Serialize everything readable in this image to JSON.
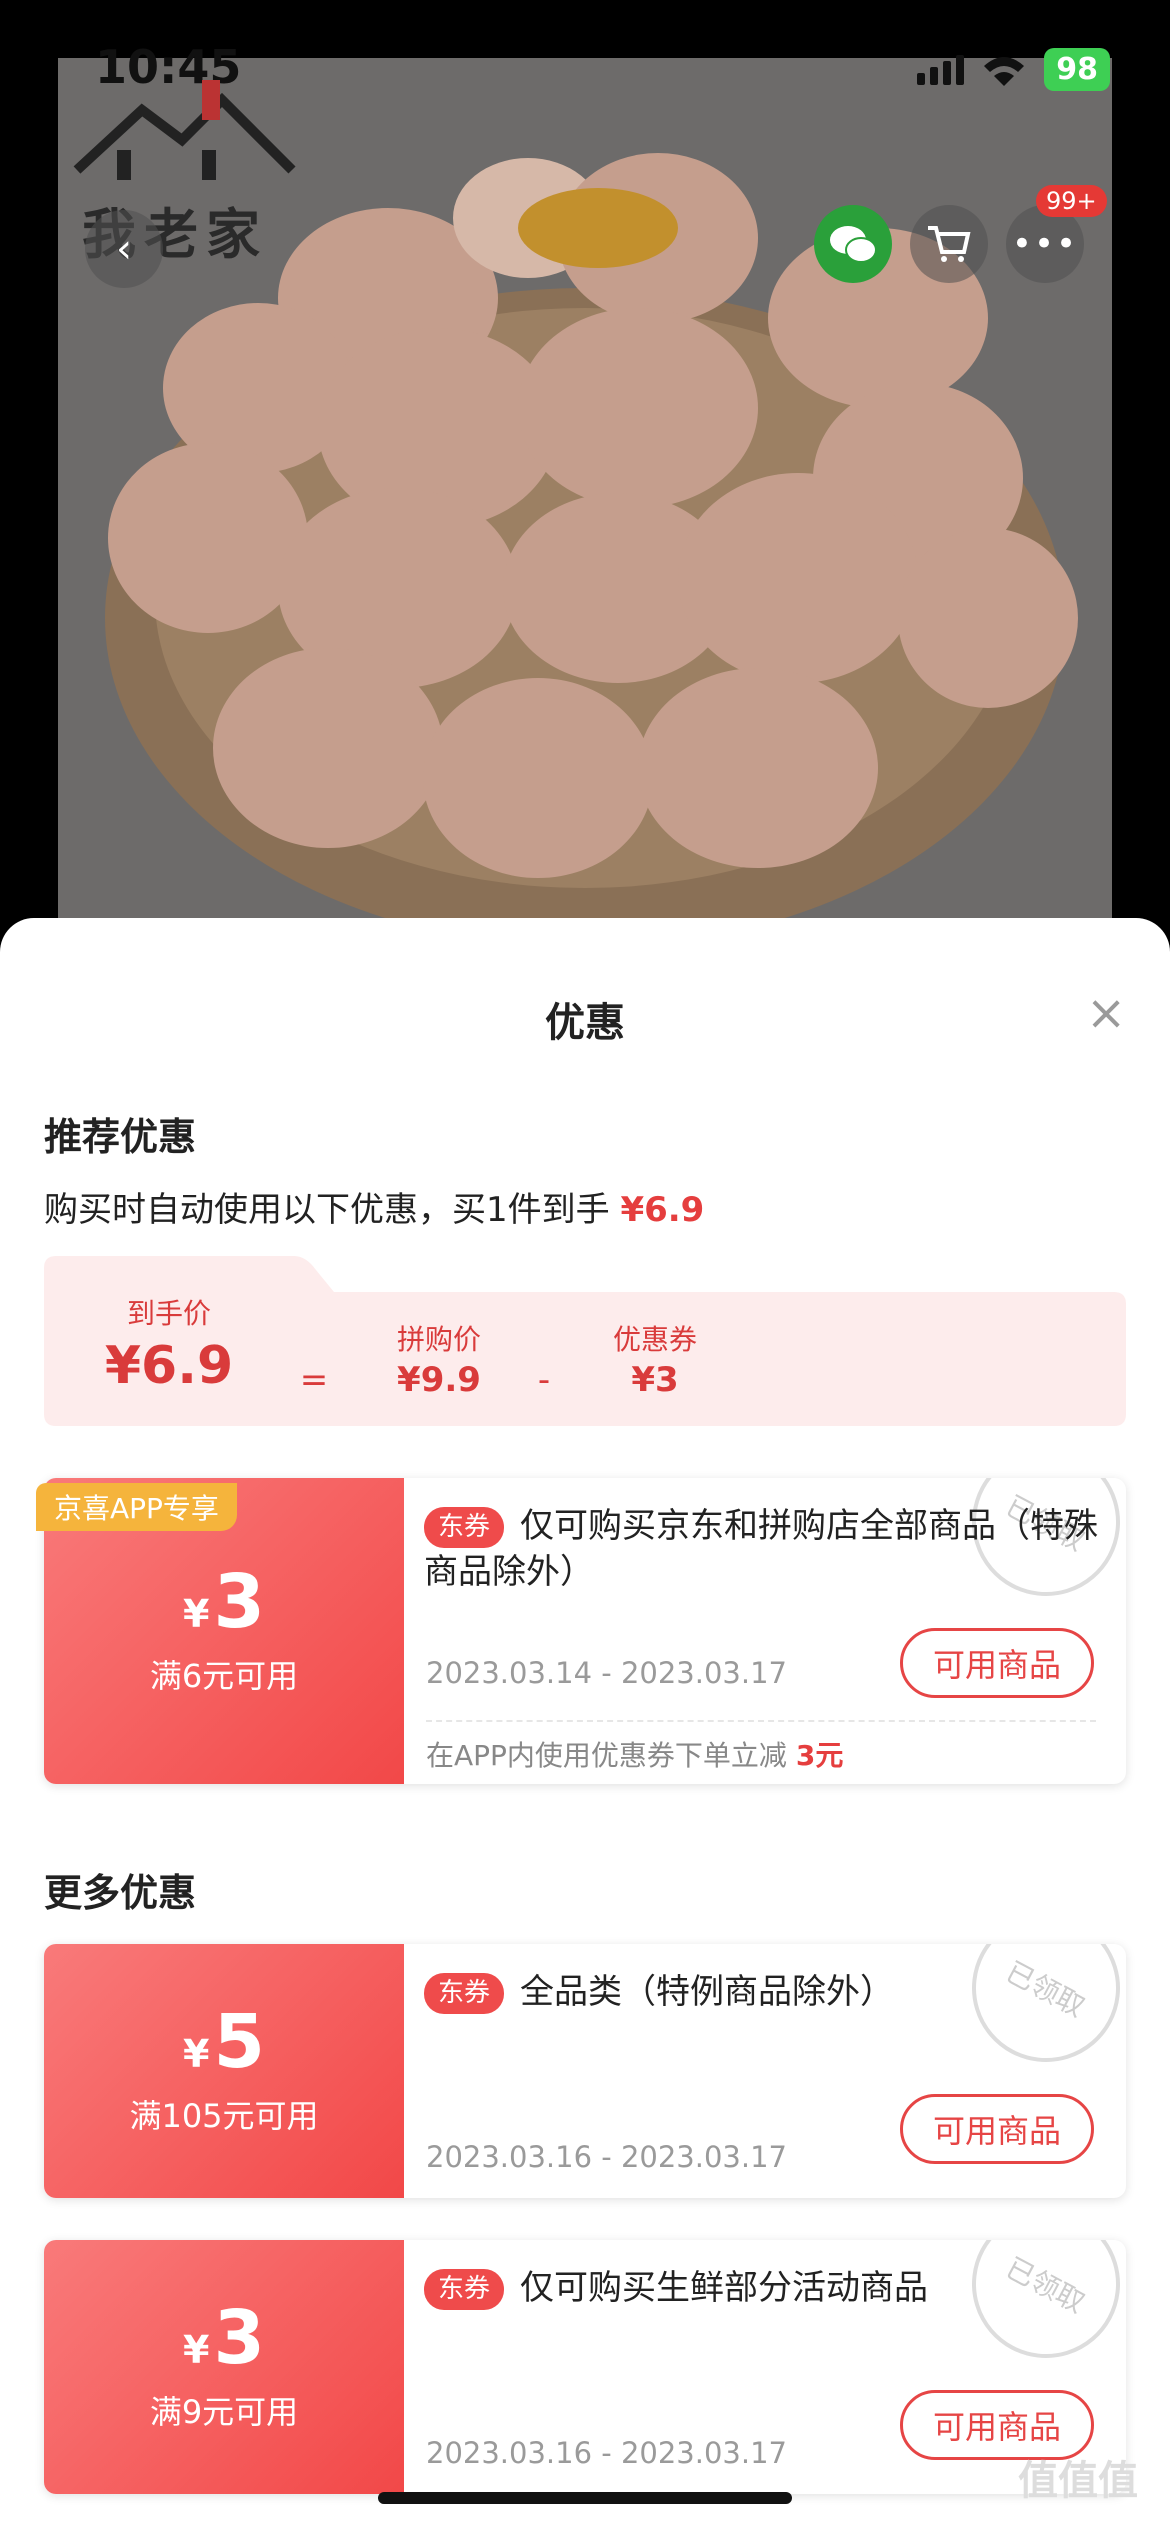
{
  "status_bar": {
    "time": "10:45",
    "battery": "98"
  },
  "product": {
    "logo_text": "我老家",
    "cart_badge": "99+"
  },
  "sheet": {
    "title": "优惠",
    "close_symbol": "×",
    "recommended": {
      "heading": "推荐优惠",
      "desc_prefix": "购买时自动使用以下优惠，买1件到手",
      "desc_price": "¥6.9",
      "summary": {
        "final_label": "到手价",
        "final_value": "¥6.9",
        "eq": "=",
        "group_label": "拼购价",
        "group_value": "¥9.9",
        "minus": "-",
        "coupon_label": "优惠券",
        "coupon_value": "¥3"
      }
    },
    "featured_coupon": {
      "ribbon": "京喜APP专享",
      "currency": "¥",
      "amount": "3",
      "condition": "满6元可用",
      "tag": "东券",
      "title": "仅可购买京东和拼购店全部商品（特殊商品除外）",
      "date": "2023.03.14 - 2023.03.17",
      "button": "可用商品",
      "stamp": "已领取",
      "note_prefix": "在APP内使用优惠券下单立减",
      "note_value": "3元"
    },
    "more": {
      "heading": "更多优惠",
      "coupons": [
        {
          "currency": "¥",
          "amount": "5",
          "condition": "满105元可用",
          "tag": "东券",
          "title": "全品类（特例商品除外）",
          "date": "2023.03.16 - 2023.03.17",
          "button": "可用商品",
          "stamp": "已领取"
        },
        {
          "currency": "¥",
          "amount": "3",
          "condition": "满9元可用",
          "tag": "东券",
          "title": "仅可购买生鲜部分活动商品",
          "date": "2023.03.16 - 2023.03.17",
          "button": "可用商品",
          "stamp": "已领取"
        }
      ]
    }
  },
  "watermark": "值值值"
}
